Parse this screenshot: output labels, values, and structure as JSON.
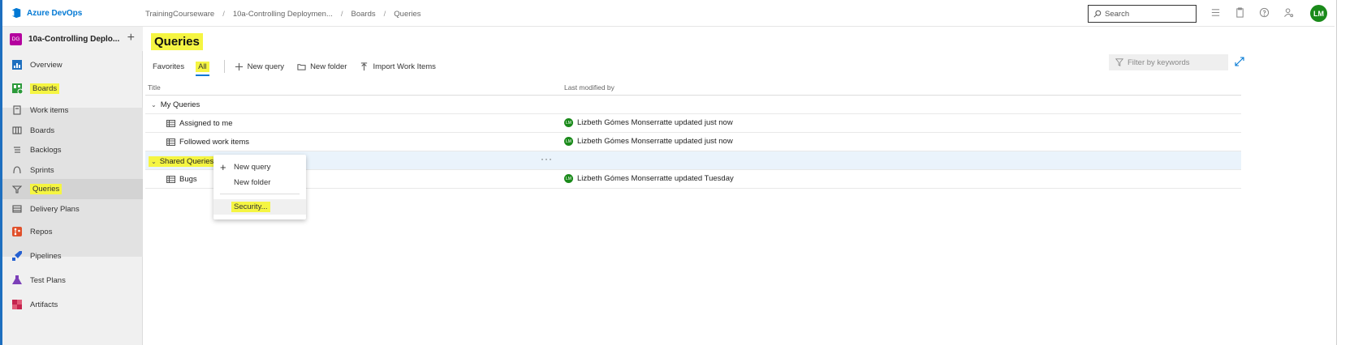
{
  "app": {
    "brand": "Azure DevOps"
  },
  "breadcrumb": [
    "TrainingCourseware",
    "10a-Controlling Deploymen...",
    "Boards",
    "Queries"
  ],
  "search": {
    "placeholder": "Search"
  },
  "user": {
    "initials": "LM"
  },
  "project": {
    "badge": "DG",
    "name": "10a-Controlling Deplo..."
  },
  "nav": {
    "overview": "Overview",
    "boards": "Boards",
    "work_items": "Work items",
    "boards_sub": "Boards",
    "backlogs": "Backlogs",
    "sprints": "Sprints",
    "queries": "Queries",
    "delivery_plans": "Delivery Plans",
    "repos": "Repos",
    "pipelines": "Pipelines",
    "test_plans": "Test Plans",
    "artifacts": "Artifacts"
  },
  "page": {
    "title": "Queries"
  },
  "toolbar": {
    "favorites": "Favorites",
    "all": "All",
    "new_query": "New query",
    "new_folder": "New folder",
    "import": "Import Work Items",
    "filter_placeholder": "Filter by keywords"
  },
  "table": {
    "col_title": "Title",
    "col_modified": "Last modified by",
    "my_queries": "My Queries",
    "shared_queries": "Shared Queries",
    "rows": [
      {
        "title": "Assigned to me",
        "modified": "Lizbeth Gómes Monserratte updated just now"
      },
      {
        "title": "Followed work items",
        "modified": "Lizbeth Gómes Monserratte updated just now"
      },
      {
        "title": "Bugs",
        "modified": "Lizbeth Gómes Monserratte updated Tuesday"
      }
    ],
    "avatar_initials": "LM"
  },
  "context_menu": {
    "new_query": "New query",
    "new_folder": "New folder",
    "security": "Security..."
  },
  "colors": {
    "accent": "#0078d4",
    "highlight": "#f5f542",
    "avatar": "#1a8a1a",
    "project_badge": "#b4009e"
  }
}
